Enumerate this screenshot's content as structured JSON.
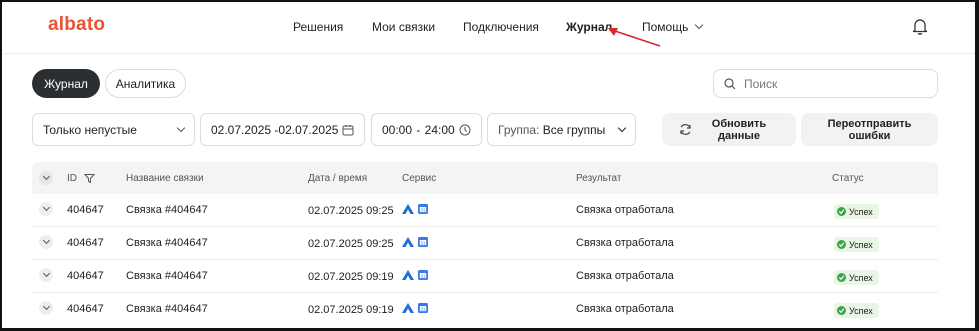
{
  "header": {
    "logo": "albato",
    "nav": [
      "Решения",
      "Мои связки",
      "Подключения",
      "Журнал",
      "Помощь"
    ],
    "active_nav": "Журнал"
  },
  "tabs": {
    "journal": "Журнал",
    "analytics": "Аналитика"
  },
  "search": {
    "placeholder": "Поиск"
  },
  "filters": {
    "type": "Только непустые",
    "date_range": "02.07.2025 -02.07.2025",
    "time_from": "00:00",
    "time_sep": "-",
    "time_to": "24:00",
    "group_label": "Группа:",
    "group_value": "Все группы"
  },
  "buttons": {
    "refresh": "Обновить данные",
    "resend": "Переотправить ошибки"
  },
  "table": {
    "columns": {
      "id": "ID",
      "name": "Название связки",
      "datetime": "Дата / время",
      "service": "Сервис",
      "result": "Результат",
      "status": "Статус"
    },
    "rows": [
      {
        "id": "404647",
        "name": "Связка #404647",
        "datetime": "02.07.2025 09:25",
        "result": "Связка отработала",
        "status": "Успех"
      },
      {
        "id": "404647",
        "name": "Связка #404647",
        "datetime": "02.07.2025 09:25",
        "result": "Связка отработала",
        "status": "Успех"
      },
      {
        "id": "404647",
        "name": "Связка #404647",
        "datetime": "02.07.2025 09:19",
        "result": "Связка отработала",
        "status": "Успех"
      },
      {
        "id": "404647",
        "name": "Связка #404647",
        "datetime": "02.07.2025 09:19",
        "result": "Связка отработала",
        "status": "Успех"
      }
    ]
  },
  "icons": {
    "service_a": "albato-service-icon",
    "service_b": "calendar-service-icon"
  },
  "colors": {
    "brand": "#e85530",
    "annotation_arrow": "#d9262c",
    "success": "#3ba54a"
  }
}
